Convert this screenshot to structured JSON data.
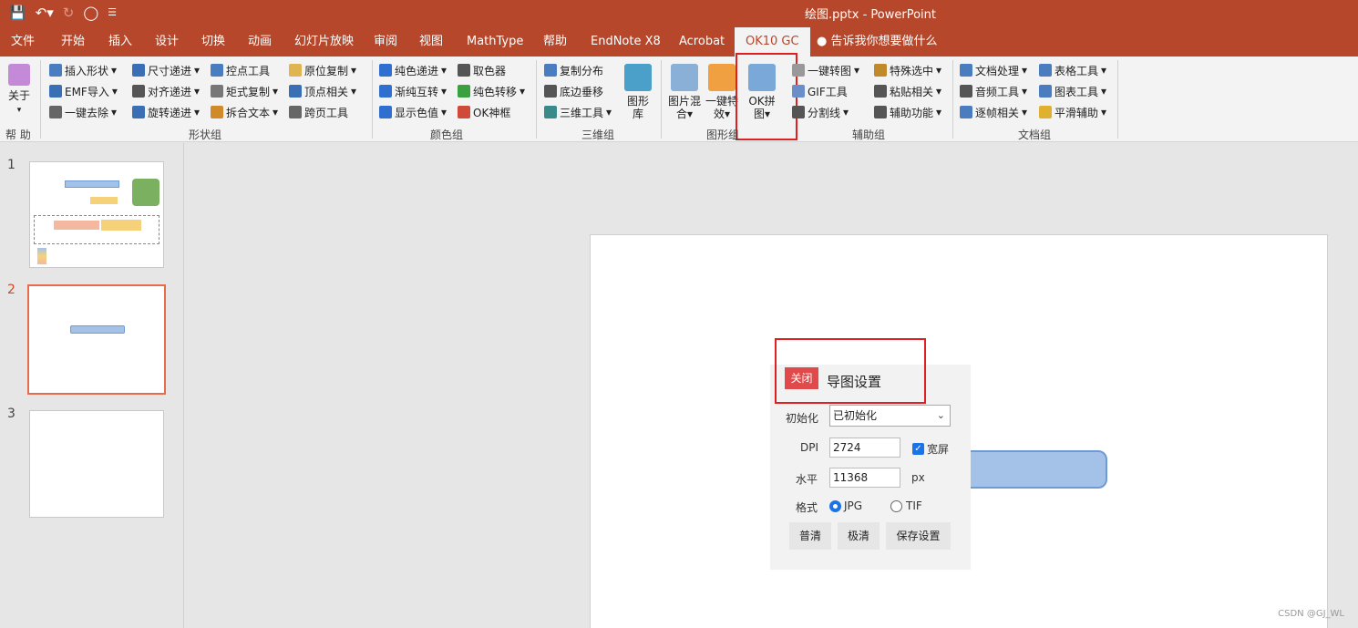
{
  "window": {
    "title": "绘图.pptx  -  PowerPoint",
    "quick_access": [
      "save-icon",
      "undo-icon",
      "redo-icon",
      "present-icon",
      "customize-icon"
    ]
  },
  "tabs": [
    {
      "label": "文件"
    },
    {
      "label": "开始"
    },
    {
      "label": "插入"
    },
    {
      "label": "设计"
    },
    {
      "label": "切换"
    },
    {
      "label": "动画"
    },
    {
      "label": "幻灯片放映"
    },
    {
      "label": "审阅"
    },
    {
      "label": "视图"
    },
    {
      "label": "MathType"
    },
    {
      "label": "帮助"
    },
    {
      "label": "EndNote X8"
    },
    {
      "label": "Acrobat"
    },
    {
      "label": "OK10 GC"
    }
  ],
  "tell_me": "告诉我你想要做什么",
  "ribbon": {
    "help": {
      "about": "关于",
      "group": "帮 助"
    },
    "shape_group": {
      "items": [
        "插入形状",
        "EMF导入",
        "一键去除",
        "尺寸递进",
        "对齐递进",
        "旋转递进",
        "控点工具",
        "矩式复制",
        "拆合文本",
        "原位复制",
        "顶点相关",
        "跨页工具"
      ],
      "group": "形状组"
    },
    "color_group": {
      "items": [
        "纯色递进",
        "渐纯互转",
        "显示色值",
        "取色器",
        "纯色转移",
        "OK神框"
      ],
      "group": "颜色组"
    },
    "threed_group": {
      "items": [
        "复制分布",
        "底边垂移",
        "三维工具",
        "图形库"
      ],
      "group": "三维组"
    },
    "graphic_group": {
      "items": [
        "图片混合",
        "一键特效",
        "OK拼图"
      ],
      "group": "图形组"
    },
    "assist_group": {
      "items": [
        "一键转图",
        "GIF工具",
        "分割线",
        "特殊选中",
        "粘贴相关",
        "辅助功能"
      ],
      "group": "辅助组"
    },
    "doc_group": {
      "items": [
        "文档处理",
        "音频工具",
        "逐帧相关",
        "表格工具",
        "图表工具",
        "平滑辅助"
      ],
      "group": "文档组"
    }
  },
  "slides": [
    {
      "number": "1"
    },
    {
      "number": "2"
    },
    {
      "number": "3"
    }
  ],
  "dialog": {
    "close": "关闭",
    "title": "导图设置",
    "init_label": "初始化",
    "init_value": "已初始化",
    "dpi_label": "DPI",
    "dpi_value": "2724",
    "widescreen_label": "宽屏",
    "widescreen_checked": true,
    "horizontal_label": "水平",
    "horizontal_value": "11368",
    "horizontal_unit": "px",
    "format_label": "格式",
    "format_jpg": "JPG",
    "format_tif": "TIF",
    "format_selected": "JPG",
    "buttons": [
      "普清",
      "极清",
      "保存设置"
    ]
  },
  "watermark": "CSDN @GJ_WL",
  "colors": {
    "accent": "#b7472a",
    "highlight": "#e02020",
    "check": "#1a73e8"
  }
}
